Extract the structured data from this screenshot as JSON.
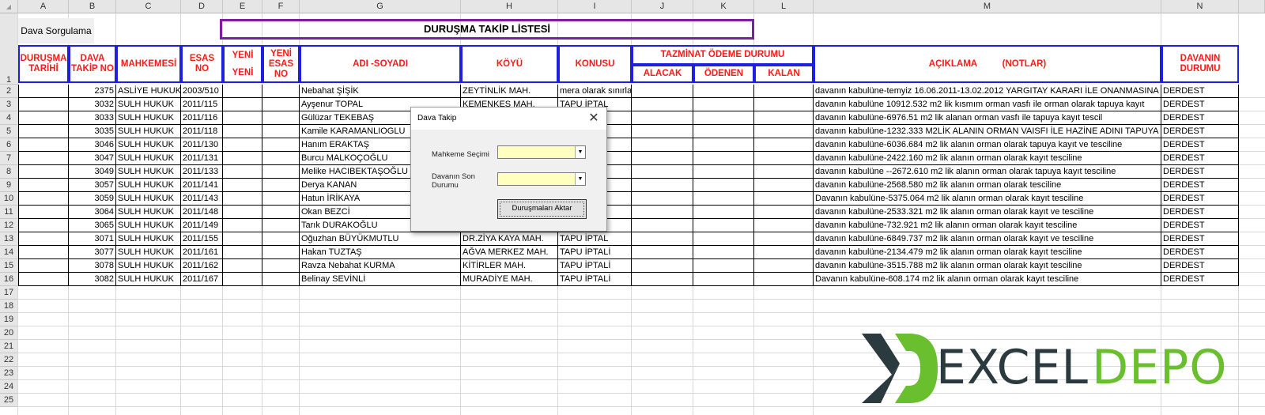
{
  "columns": [
    "A",
    "B",
    "C",
    "D",
    "E",
    "F",
    "G",
    "H",
    "I",
    "J",
    "K",
    "L",
    "M",
    "N"
  ],
  "rows": [
    "1",
    "2",
    "3",
    "4",
    "5",
    "6",
    "7",
    "8",
    "9",
    "10",
    "11",
    "12",
    "13",
    "14",
    "15",
    "16",
    "17",
    "18",
    "19",
    "20",
    "21",
    "22",
    "23",
    "24",
    "25"
  ],
  "sorgu_button": "Dava Sorgulama",
  "title": "DURUŞMA TAKİP LİSTESİ",
  "headers": {
    "durusma": "DURUŞMA TARİHİ",
    "takip": "DAVA TAKİP NO",
    "mahkemesi": "MAHKEMESİ",
    "esas": "ESAS NO",
    "yeni_e_1": "YENİ",
    "yeni_e_2": "YENİ",
    "yeni_esas": "YENİ ESAS NO",
    "adi": "ADI -SOYADI",
    "koyu": "KÖYÜ",
    "konusu": "KONUSU",
    "tazminat": "TAZMİNAT ÖDEME DURUMU",
    "alacak": "ALACAK",
    "odenen": "ÖDENEN",
    "kalan": "KALAN",
    "aciklama": "AÇIKLAMA          (NOTLAR)",
    "durum": "DAVANIN DURUMU"
  },
  "records": [
    {
      "takip": "2375",
      "mahkeme": "ASLİYE HUKUK",
      "esas": "2003/510",
      "ad": "Nebahat ŞİŞİK",
      "koy": "ZEYTİNLİK MAH.",
      "konu": "mera olarak sınırlandırılmasına",
      "aciklama": "davanın kabulüne-temyiz 16.06.2011-13.02.2012 YARGITAY KARARI İLE ONANMASINA",
      "durum": "DERDEST"
    },
    {
      "takip": "3032",
      "mahkeme": "SULH HUKUK",
      "esas": "2011/115",
      "ad": "Ayşenur TOPAL",
      "koy": "KEMENKES MAH.",
      "konu": "TAPU İPTAL",
      "aciklama": "davanın kabulüne 10912.532 m2 lik kısmım orman vasfı ile orman olarak tapuya kayıt",
      "durum": "DERDEST"
    },
    {
      "takip": "3033",
      "mahkeme": "SULH HUKUK",
      "esas": "2011/116",
      "ad": "Gülüzar TEKEBAŞ",
      "koy": "",
      "konu": "",
      "aciklama": "davanın kabulüne-6976.51 m2 lik alanan  orman vasfı ile tapuya kayıt tescil",
      "durum": "DERDEST"
    },
    {
      "takip": "3035",
      "mahkeme": "SULH HUKUK",
      "esas": "2011/118",
      "ad": "Kamile KARAMANLIOGLU",
      "koy": "",
      "konu": "",
      "aciklama": "davanın kabulüne-1232.333 M2LİK ALANIN ORMAN VAISFI İLE HAZİNE ADINI TAPUYA",
      "durum": "DERDEST"
    },
    {
      "takip": "3046",
      "mahkeme": "SULH HUKUK",
      "esas": "2011/130",
      "ad": "Hanım ERAKTAŞ",
      "koy": "",
      "konu": "",
      "aciklama": "davanın kabulüne-6036.684 m2 lik alanın orman olarak tapuya kayıt ve tesciline",
      "durum": "DERDEST"
    },
    {
      "takip": "3047",
      "mahkeme": "SULH HUKUK",
      "esas": "2011/131",
      "ad": "Burcu MALKOÇOĞLU",
      "koy": "",
      "konu": "",
      "aciklama": "davanın kabulüne-2422.160 m2 lik alanın orman olarak kayıt tesciline",
      "durum": "DERDEST"
    },
    {
      "takip": "3049",
      "mahkeme": "SULH HUKUK",
      "esas": "2011/133",
      "ad": "Melike HACIBEKTAŞOĞLU",
      "koy": "",
      "konu": "",
      "aciklama": "davanın kabulüne --2672.610 m2 lik alanın orman olarak tapuya kayıt tesciline",
      "durum": "DERDEST"
    },
    {
      "takip": "3057",
      "mahkeme": "SULH HUKUK",
      "esas": "2011/141",
      "ad": "Derya KANAN",
      "koy": "",
      "konu": "",
      "aciklama": "davanın kabulüne-2568.580 m2 lik alanın orman olarak tesciline",
      "durum": "DERDEST"
    },
    {
      "takip": "3059",
      "mahkeme": "SULH HUKUK",
      "esas": "2011/143",
      "ad": "Hatun İRİKAYA",
      "koy": "",
      "konu": "",
      "aciklama": "Davanın kabulüne-5375.064 m2 lik alanın orman olarak kayıt tesciline",
      "durum": "DERDEST"
    },
    {
      "takip": "3064",
      "mahkeme": "SULH HUKUK",
      "esas": "2011/148",
      "ad": "Okan BEZCİ",
      "koy": "",
      "konu": "",
      "aciklama": "davanın kabulüne-2533.321 m2 lik alanın orman olarak kayıt ve tesciline",
      "durum": "DERDEST"
    },
    {
      "takip": "3065",
      "mahkeme": "SULH HUKUK",
      "esas": "2011/149",
      "ad": "Tarık DURAKOĞLU",
      "koy": "",
      "konu": "",
      "aciklama": "davanın kabulüne-732.921 m2 lik alanın orman olarak kayıt tesciline",
      "durum": "DERDEST"
    },
    {
      "takip": "3071",
      "mahkeme": "SULH HUKUK",
      "esas": "2011/155",
      "ad": "Oğuzhan BÜYÜKMUTLU",
      "koy": "DR.ZİYA KAYA MAH.",
      "konu": "TAPU İPTAL",
      "aciklama": "davanın kabulüne-6849.737 m2 lik alanın orman olarak kayıt ve tesciline",
      "durum": "DERDEST"
    },
    {
      "takip": "3077",
      "mahkeme": "SULH HUKUK",
      "esas": "2011/161",
      "ad": "Hakan TUZTAŞ",
      "koy": "AĞVA MERKEZ MAH.",
      "konu": "TAPU İPTALİ",
      "aciklama": "davanın kabulüne-2134.479 m2 lik alanın orman olarak kayıt tesciline",
      "durum": "DERDEST"
    },
    {
      "takip": "3078",
      "mahkeme": "SULH HUKUK",
      "esas": "2011/162",
      "ad": "Ravza Nebahat KURMA",
      "koy": "KİTİRLER MAH.",
      "konu": "TAPU İPTALİ",
      "aciklama": "davanın kabulüne-3515.788 m2 lik alanın orman olarak kayıt tesciline",
      "durum": "DERDEST"
    },
    {
      "takip": "3082",
      "mahkeme": "SULH HUKUK",
      "esas": "2011/167",
      "ad": "Belinay SEVİNLİ",
      "koy": "MURADİYE MAH.",
      "konu": "TAPU İPTALİ",
      "aciklama": "Davanın kabulüne-608.174 m2 lik alanın orman olarak kayıt tesciline",
      "durum": "DERDEST"
    }
  ],
  "dialog": {
    "title": "Dava Takip",
    "label_mahkeme": "Mahkeme Seçimi",
    "label_durum_1": "Davanın Son",
    "label_durum_2": "Durumu",
    "mahkeme_value": "",
    "durum_value": "",
    "button": "Duruşmaları Aktar"
  },
  "logo": {
    "left": "EXCEL",
    "right": "DEPO"
  },
  "colors": {
    "header_text": "#ff1a1a",
    "header_border": "#1f1fe0",
    "title_border": "#7b1fa2",
    "combo_bg": "#ffffc0",
    "logo_dark": "#2b3a3f",
    "logo_green": "#6abf2e"
  }
}
